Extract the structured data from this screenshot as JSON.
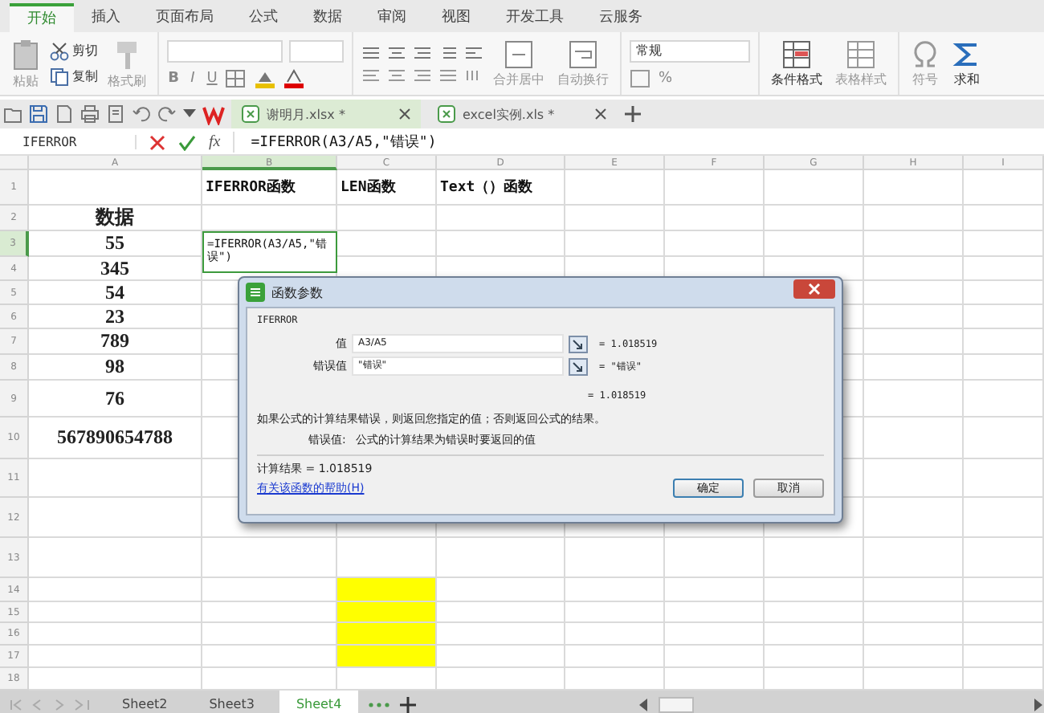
{
  "menu_tabs": [
    {
      "label": "开始",
      "selected": true
    },
    {
      "label": "插入",
      "selected": false
    },
    {
      "label": "页面布局",
      "selected": false
    },
    {
      "label": "公式",
      "selected": false
    },
    {
      "label": "数据",
      "selected": false
    },
    {
      "label": "审阅",
      "selected": false
    },
    {
      "label": "视图",
      "selected": false
    },
    {
      "label": "开发工具",
      "selected": false
    },
    {
      "label": "云服务",
      "selected": false
    }
  ],
  "ribbon": {
    "paste": "粘贴",
    "cut": "剪切",
    "copy": "复制",
    "format_painter": "格式刷",
    "font_styles": [
      "B",
      "I",
      "U"
    ],
    "merge": "合并居中",
    "wrap": "自动换行",
    "number_format": "常规",
    "percent": "%",
    "conditional_format": "条件格式",
    "table_style": "表格样式",
    "symbol": "符号",
    "sum": "求和"
  },
  "doc_tabs": [
    {
      "label": "谢明月.xlsx *",
      "selected": true
    },
    {
      "label": "excel实例.xls *",
      "selected": false
    }
  ],
  "formula_bar": {
    "name_box": "IFERROR",
    "fx": "fx",
    "formula": "=IFERROR(A3/A5,\"错误\")"
  },
  "columns": [
    {
      "label": "A",
      "selected": false
    },
    {
      "label": "B",
      "selected": true
    },
    {
      "label": "C",
      "selected": false
    },
    {
      "label": "D",
      "selected": false
    },
    {
      "label": "E",
      "selected": false
    },
    {
      "label": "F",
      "selected": false
    },
    {
      "label": "G",
      "selected": false
    },
    {
      "label": "H",
      "selected": false
    },
    {
      "label": "I",
      "selected": false
    }
  ],
  "rows": [
    {
      "number": "1",
      "selected": false,
      "cells": [
        null,
        {
          "text": "IFERROR函数"
        },
        {
          "text": "LEN函数"
        },
        {
          "text": "Text（）函数"
        },
        null,
        null,
        null,
        null,
        null
      ]
    },
    {
      "number": "2",
      "selected": false,
      "cells": [
        {
          "text": "数据"
        },
        null,
        null,
        null,
        null,
        null,
        null,
        null,
        null
      ]
    },
    {
      "number": "3",
      "selected": true,
      "cells": [
        {
          "text": "55"
        },
        {
          "text": "=IFERROR(A3/A5,\"错误\")"
        },
        null,
        null,
        null,
        null,
        null,
        null,
        null
      ]
    },
    {
      "number": "4",
      "selected": false,
      "cells": [
        {
          "text": "345"
        },
        null,
        null,
        null,
        null,
        null,
        null,
        null,
        null
      ]
    },
    {
      "number": "5",
      "selected": false,
      "cells": [
        {
          "text": "54"
        },
        null,
        null,
        null,
        null,
        null,
        null,
        null,
        null
      ]
    },
    {
      "number": "6",
      "selected": false,
      "cells": [
        {
          "text": "23"
        },
        null,
        null,
        null,
        null,
        null,
        null,
        null,
        null
      ]
    },
    {
      "number": "7",
      "selected": false,
      "cells": [
        {
          "text": "789"
        },
        null,
        null,
        null,
        null,
        null,
        null,
        null,
        null
      ]
    },
    {
      "number": "8",
      "selected": false,
      "cells": [
        {
          "text": "98"
        },
        null,
        null,
        null,
        null,
        null,
        null,
        null,
        null
      ]
    },
    {
      "number": "9",
      "selected": false,
      "cells": [
        {
          "text": "76"
        },
        null,
        null,
        null,
        null,
        null,
        null,
        null,
        null
      ]
    },
    {
      "number": "10",
      "selected": false,
      "cells": [
        {
          "text": "567890654788"
        },
        null,
        null,
        null,
        null,
        null,
        null,
        null,
        null
      ]
    },
    {
      "number": "11",
      "selected": false,
      "cells": [
        null,
        null,
        null,
        null,
        null,
        null,
        null,
        null,
        null
      ]
    },
    {
      "number": "12",
      "selected": false,
      "cells": [
        null,
        null,
        null,
        null,
        null,
        null,
        null,
        null,
        null
      ]
    },
    {
      "number": "13",
      "selected": false,
      "cells": [
        null,
        null,
        null,
        null,
        null,
        null,
        null,
        null,
        null
      ]
    },
    {
      "number": "14",
      "selected": false,
      "cells": [
        null,
        null,
        {
          "color": "#ffff00"
        },
        null,
        null,
        null,
        null,
        null,
        null
      ]
    },
    {
      "number": "15",
      "selected": false,
      "cells": [
        null,
        null,
        {
          "color": "#ffff00"
        },
        null,
        null,
        null,
        null,
        null,
        null
      ]
    },
    {
      "number": "16",
      "selected": false,
      "cells": [
        null,
        null,
        {
          "color": "#ffff00"
        },
        null,
        null,
        null,
        null,
        null,
        null
      ]
    },
    {
      "number": "17",
      "selected": false,
      "cells": [
        null,
        null,
        {
          "color": "#ffff00"
        },
        null,
        null,
        null,
        null,
        null,
        null
      ]
    },
    {
      "number": "18",
      "selected": false,
      "cells": [
        null,
        null,
        null,
        null,
        null,
        null,
        null,
        null,
        null
      ]
    }
  ],
  "dialog": {
    "title": "函数参数",
    "function_name": "IFERROR",
    "args": [
      {
        "label": "值",
        "value": "A3/A5",
        "result": "= 1.018519"
      },
      {
        "label": "错误值",
        "value": "\"错误\"",
        "result": "= \"错误\""
      }
    ],
    "formula_result": "= 1.018519",
    "description": "如果公式的计算结果错误，则返回您指定的值；否则返回公式的结果。",
    "arg_help_label": "错误值:",
    "arg_help": "公式的计算结果为错误时要返回的值",
    "calc_result": "计算结果 = 1.018519",
    "help_link": "有关该函数的帮助(H)",
    "buttons": [
      "确定",
      "取消"
    ]
  },
  "sheet_tabs": [
    {
      "label": "Sheet2",
      "selected": false
    },
    {
      "label": "Sheet3",
      "selected": false
    },
    {
      "label": "Sheet4",
      "selected": true
    }
  ]
}
